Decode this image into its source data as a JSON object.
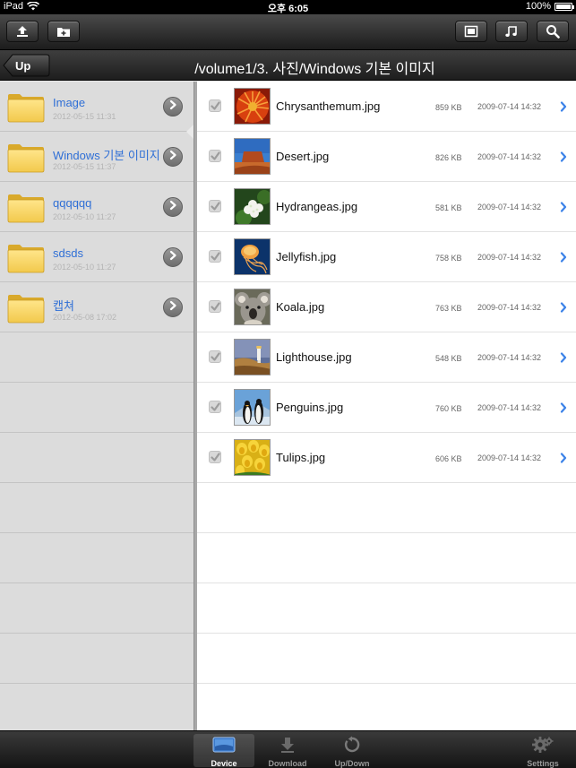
{
  "status_bar": {
    "device": "iPad",
    "time": "오후 6:05",
    "battery": "100%",
    "battery_level": 1.0
  },
  "toolbar": {
    "buttons": [
      {
        "icon": "upload-icon"
      },
      {
        "icon": "new-folder-icon"
      },
      {
        "icon": "window-icon"
      },
      {
        "icon": "music-icon"
      },
      {
        "icon": "search-icon"
      }
    ]
  },
  "nav": {
    "back_label": "Up",
    "path_title": "/volume1/3. 사진/Windows 기본 이미지"
  },
  "folders": [
    {
      "name": "Image",
      "date": "2012-05-15 11:31"
    },
    {
      "name": "Windows 기본 이미지",
      "date": "2012-05-15 11:37"
    },
    {
      "name": "qqqqqq",
      "date": "2012-05-10 11:27"
    },
    {
      "name": "sdsds",
      "date": "2012-05-10 11:27"
    },
    {
      "name": "캡쳐",
      "date": "2012-05-08 17:02"
    }
  ],
  "files": [
    {
      "name": "Chrysanthemum.jpg",
      "size": "859 KB",
      "date": "2009-07-14 14:32",
      "thumb": "chrysanthemum"
    },
    {
      "name": "Desert.jpg",
      "size": "826 KB",
      "date": "2009-07-14 14:32",
      "thumb": "desert"
    },
    {
      "name": "Hydrangeas.jpg",
      "size": "581 KB",
      "date": "2009-07-14 14:32",
      "thumb": "hydrangeas"
    },
    {
      "name": "Jellyfish.jpg",
      "size": "758 KB",
      "date": "2009-07-14 14:32",
      "thumb": "jellyfish"
    },
    {
      "name": "Koala.jpg",
      "size": "763 KB",
      "date": "2009-07-14 14:32",
      "thumb": "koala"
    },
    {
      "name": "Lighthouse.jpg",
      "size": "548 KB",
      "date": "2009-07-14 14:32",
      "thumb": "lighthouse"
    },
    {
      "name": "Penguins.jpg",
      "size": "760 KB",
      "date": "2009-07-14 14:32",
      "thumb": "penguins"
    },
    {
      "name": "Tulips.jpg",
      "size": "606 KB",
      "date": "2009-07-14 14:32",
      "thumb": "tulips"
    }
  ],
  "tabs": [
    {
      "label": "Device",
      "icon": "device-icon",
      "active": true
    },
    {
      "label": "Download",
      "icon": "download-icon",
      "active": false
    },
    {
      "label": "Up/Down",
      "icon": "updown-icon",
      "active": false
    },
    {
      "label": "Settings",
      "icon": "gear-icon",
      "active": false
    }
  ],
  "colors": {
    "folder_name": "#2f6fd6",
    "chevron": "#3b82e8",
    "active_tab_label": "#ffffff"
  }
}
